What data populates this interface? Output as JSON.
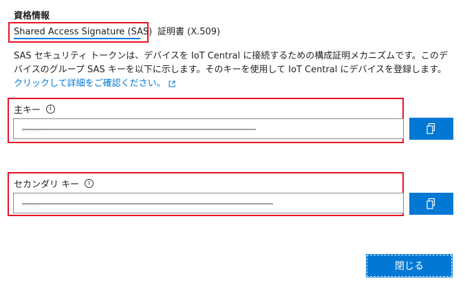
{
  "section_title": "資格情報",
  "tabs": [
    {
      "label": "Shared Access Signature (SAS)",
      "selected": true
    },
    {
      "label": "証明書 (X.509)",
      "selected": false
    }
  ],
  "description": {
    "text": "SAS セキュリティ トークンは、デバイスを IoT Central に接続するための構成証明メカニズムです。このデバイスのグループ SAS キーを以下に示します。そのキーを使用して IoT Central にデバイスを登録します。",
    "link_text": "クリックして詳細をご確認ください。",
    "link_icon": "external-link-icon"
  },
  "primary_key": {
    "label": "主キー",
    "value": "...."
  },
  "secondary_key": {
    "label": "セカンダリ キー",
    "value": "...."
  },
  "close_button": "閉じる",
  "colors": {
    "accent": "#0078d4",
    "highlight_border": "#e81123",
    "text": "#201f1e"
  }
}
